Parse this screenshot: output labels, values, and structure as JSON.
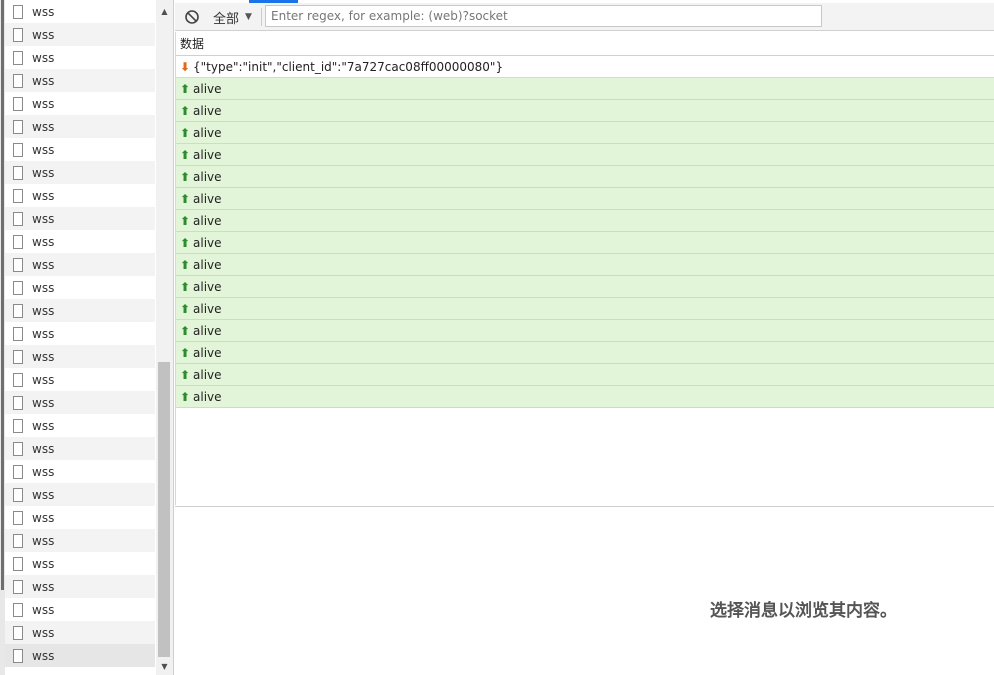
{
  "request_list": {
    "items": [
      "wss",
      "wss",
      "wss",
      "wss",
      "wss",
      "wss",
      "wss",
      "wss",
      "wss",
      "wss",
      "wss",
      "wss",
      "wss",
      "wss",
      "wss",
      "wss",
      "wss",
      "wss",
      "wss",
      "wss",
      "wss",
      "wss",
      "wss",
      "wss",
      "wss",
      "wss",
      "wss",
      "wss",
      "wss"
    ]
  },
  "toolbar": {
    "clear_icon": "block-icon",
    "filter_label": "全部",
    "filter_caret": "▼",
    "regex_placeholder": "Enter regex, for example: (web)?socket"
  },
  "messages": {
    "column_header": "数据",
    "rows": [
      {
        "direction": "received",
        "arrow": "⬇",
        "text": "{\"type\":\"init\",\"client_id\":\"7a727cac08ff00000080\"}"
      },
      {
        "direction": "sent",
        "arrow": "⬆",
        "text": "alive"
      },
      {
        "direction": "sent",
        "arrow": "⬆",
        "text": "alive"
      },
      {
        "direction": "sent",
        "arrow": "⬆",
        "text": "alive"
      },
      {
        "direction": "sent",
        "arrow": "⬆",
        "text": "alive"
      },
      {
        "direction": "sent",
        "arrow": "⬆",
        "text": "alive"
      },
      {
        "direction": "sent",
        "arrow": "⬆",
        "text": "alive"
      },
      {
        "direction": "sent",
        "arrow": "⬆",
        "text": "alive"
      },
      {
        "direction": "sent",
        "arrow": "⬆",
        "text": "alive"
      },
      {
        "direction": "sent",
        "arrow": "⬆",
        "text": "alive"
      },
      {
        "direction": "sent",
        "arrow": "⬆",
        "text": "alive"
      },
      {
        "direction": "sent",
        "arrow": "⬆",
        "text": "alive"
      },
      {
        "direction": "sent",
        "arrow": "⬆",
        "text": "alive"
      },
      {
        "direction": "sent",
        "arrow": "⬆",
        "text": "alive"
      },
      {
        "direction": "sent",
        "arrow": "⬆",
        "text": "alive"
      },
      {
        "direction": "sent",
        "arrow": "⬆",
        "text": "alive"
      }
    ]
  },
  "detail": {
    "hint": "选择消息以浏览其内容。"
  },
  "colors": {
    "sent_row_bg": "#e2f5d9",
    "sent_arrow": "#2e8b2e",
    "received_arrow": "#e06a1a",
    "active_tab": "#1a73e8"
  }
}
